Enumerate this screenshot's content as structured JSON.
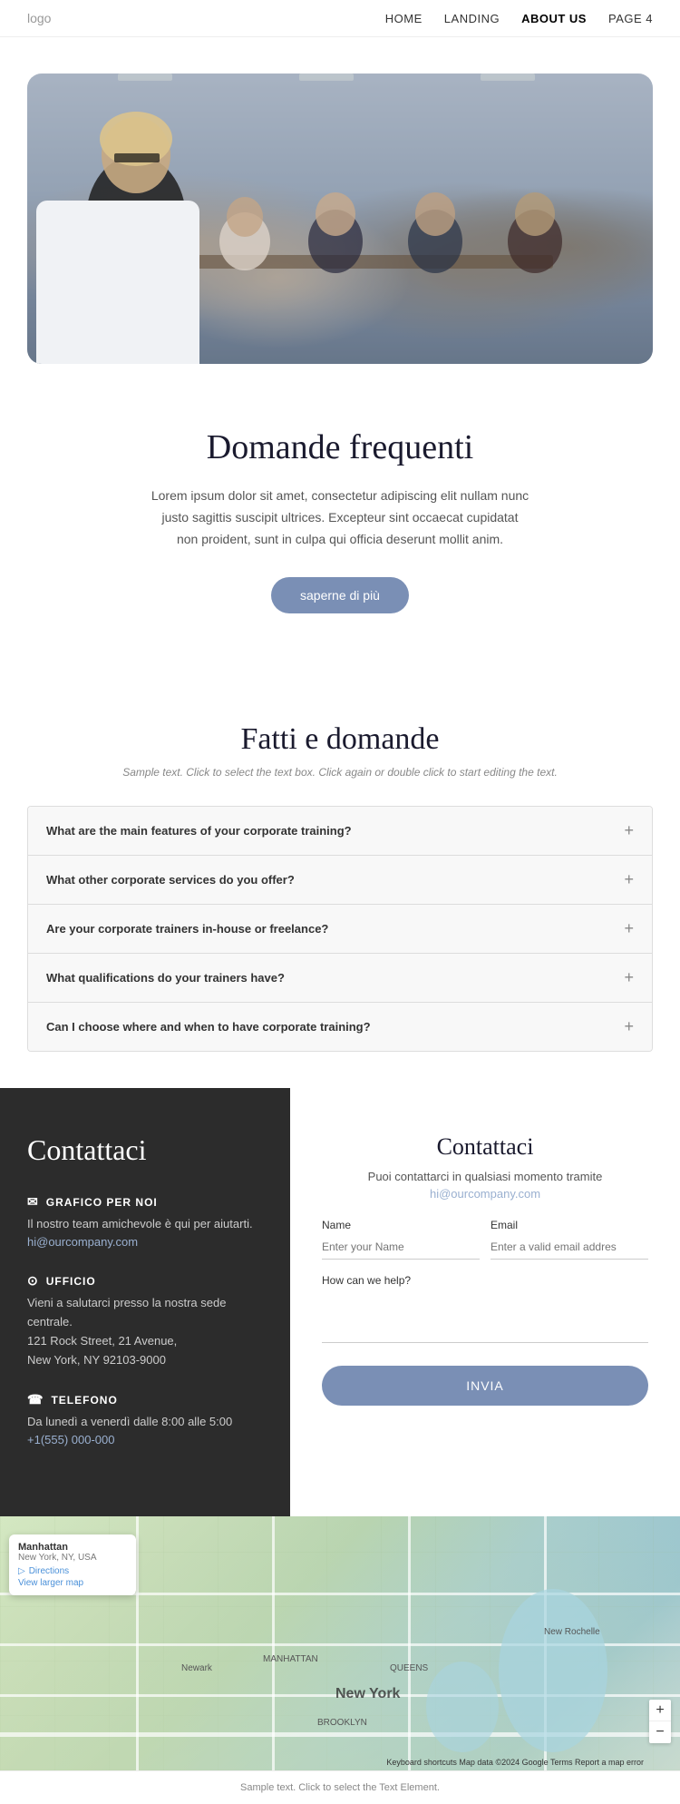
{
  "nav": {
    "logo": "logo",
    "links": [
      {
        "id": "home",
        "label": "HOME"
      },
      {
        "id": "landing",
        "label": "LANDING"
      },
      {
        "id": "about",
        "label": "ABOUT US",
        "active": true
      },
      {
        "id": "page4",
        "label": "PAGE 4"
      }
    ]
  },
  "hero": {
    "title": "Domande frequenti",
    "description": "Lorem ipsum dolor sit amet, consectetur adipiscing elit nullam nunc justo sagittis suscipit ultrices. Excepteur sint occaecat cupidatat non proident, sunt in culpa qui officia deserunt mollit anim.",
    "button_label": "saperne di più"
  },
  "faq_section": {
    "title": "Fatti e domande",
    "subtitle": "Sample text. Click to select the text box. Click again or double click to start editing the text.",
    "items": [
      {
        "id": "faq1",
        "question": "What are the main features of your corporate training?"
      },
      {
        "id": "faq2",
        "question": "What other corporate services do you offer?"
      },
      {
        "id": "faq3",
        "question": "Are your corporate trainers in-house or freelance?"
      },
      {
        "id": "faq4",
        "question": "What qualifications do your trainers have?"
      },
      {
        "id": "faq5",
        "question": "Can I choose where and when to have corporate training?"
      }
    ]
  },
  "contact_left": {
    "title": "Contattaci",
    "email_label": "GRAFICO PER NOI",
    "email_desc": "Il nostro team amichevole è qui per aiutarti.",
    "email_link": "hi@ourcompany.com",
    "office_label": "UFFICIO",
    "office_desc": "Vieni a salutarci presso la nostra sede centrale.\n121 Rock Street, 21 Avenue,\nNew York, NY 92103-9000",
    "phone_label": "TELEFONO",
    "phone_desc": "Da lunedì a venerdì dalle 8:00 alle 5:00",
    "phone_link": "+1(555) 000-000"
  },
  "contact_right": {
    "title": "Contattaci",
    "description": "Puoi contattarci in qualsiasi momento tramite",
    "email_link": "hi@ourcompany.com",
    "name_label": "Name",
    "name_placeholder": "Enter your Name",
    "email_label": "Email",
    "email_placeholder": "Enter a valid email addres",
    "help_label": "How can we help?",
    "submit_label": "INVIA"
  },
  "map": {
    "location_title": "Manhattan",
    "location_sub": "New York, NY, USA",
    "directions_label": "Directions",
    "view_larger": "View larger map",
    "attribution": "Keyboard shortcuts  Map data ©2024 Google  Terms  Report a map error",
    "zoom_in": "+",
    "zoom_out": "−"
  },
  "footer": {
    "sample_text": "Sample text. Click to select the Text Element."
  }
}
